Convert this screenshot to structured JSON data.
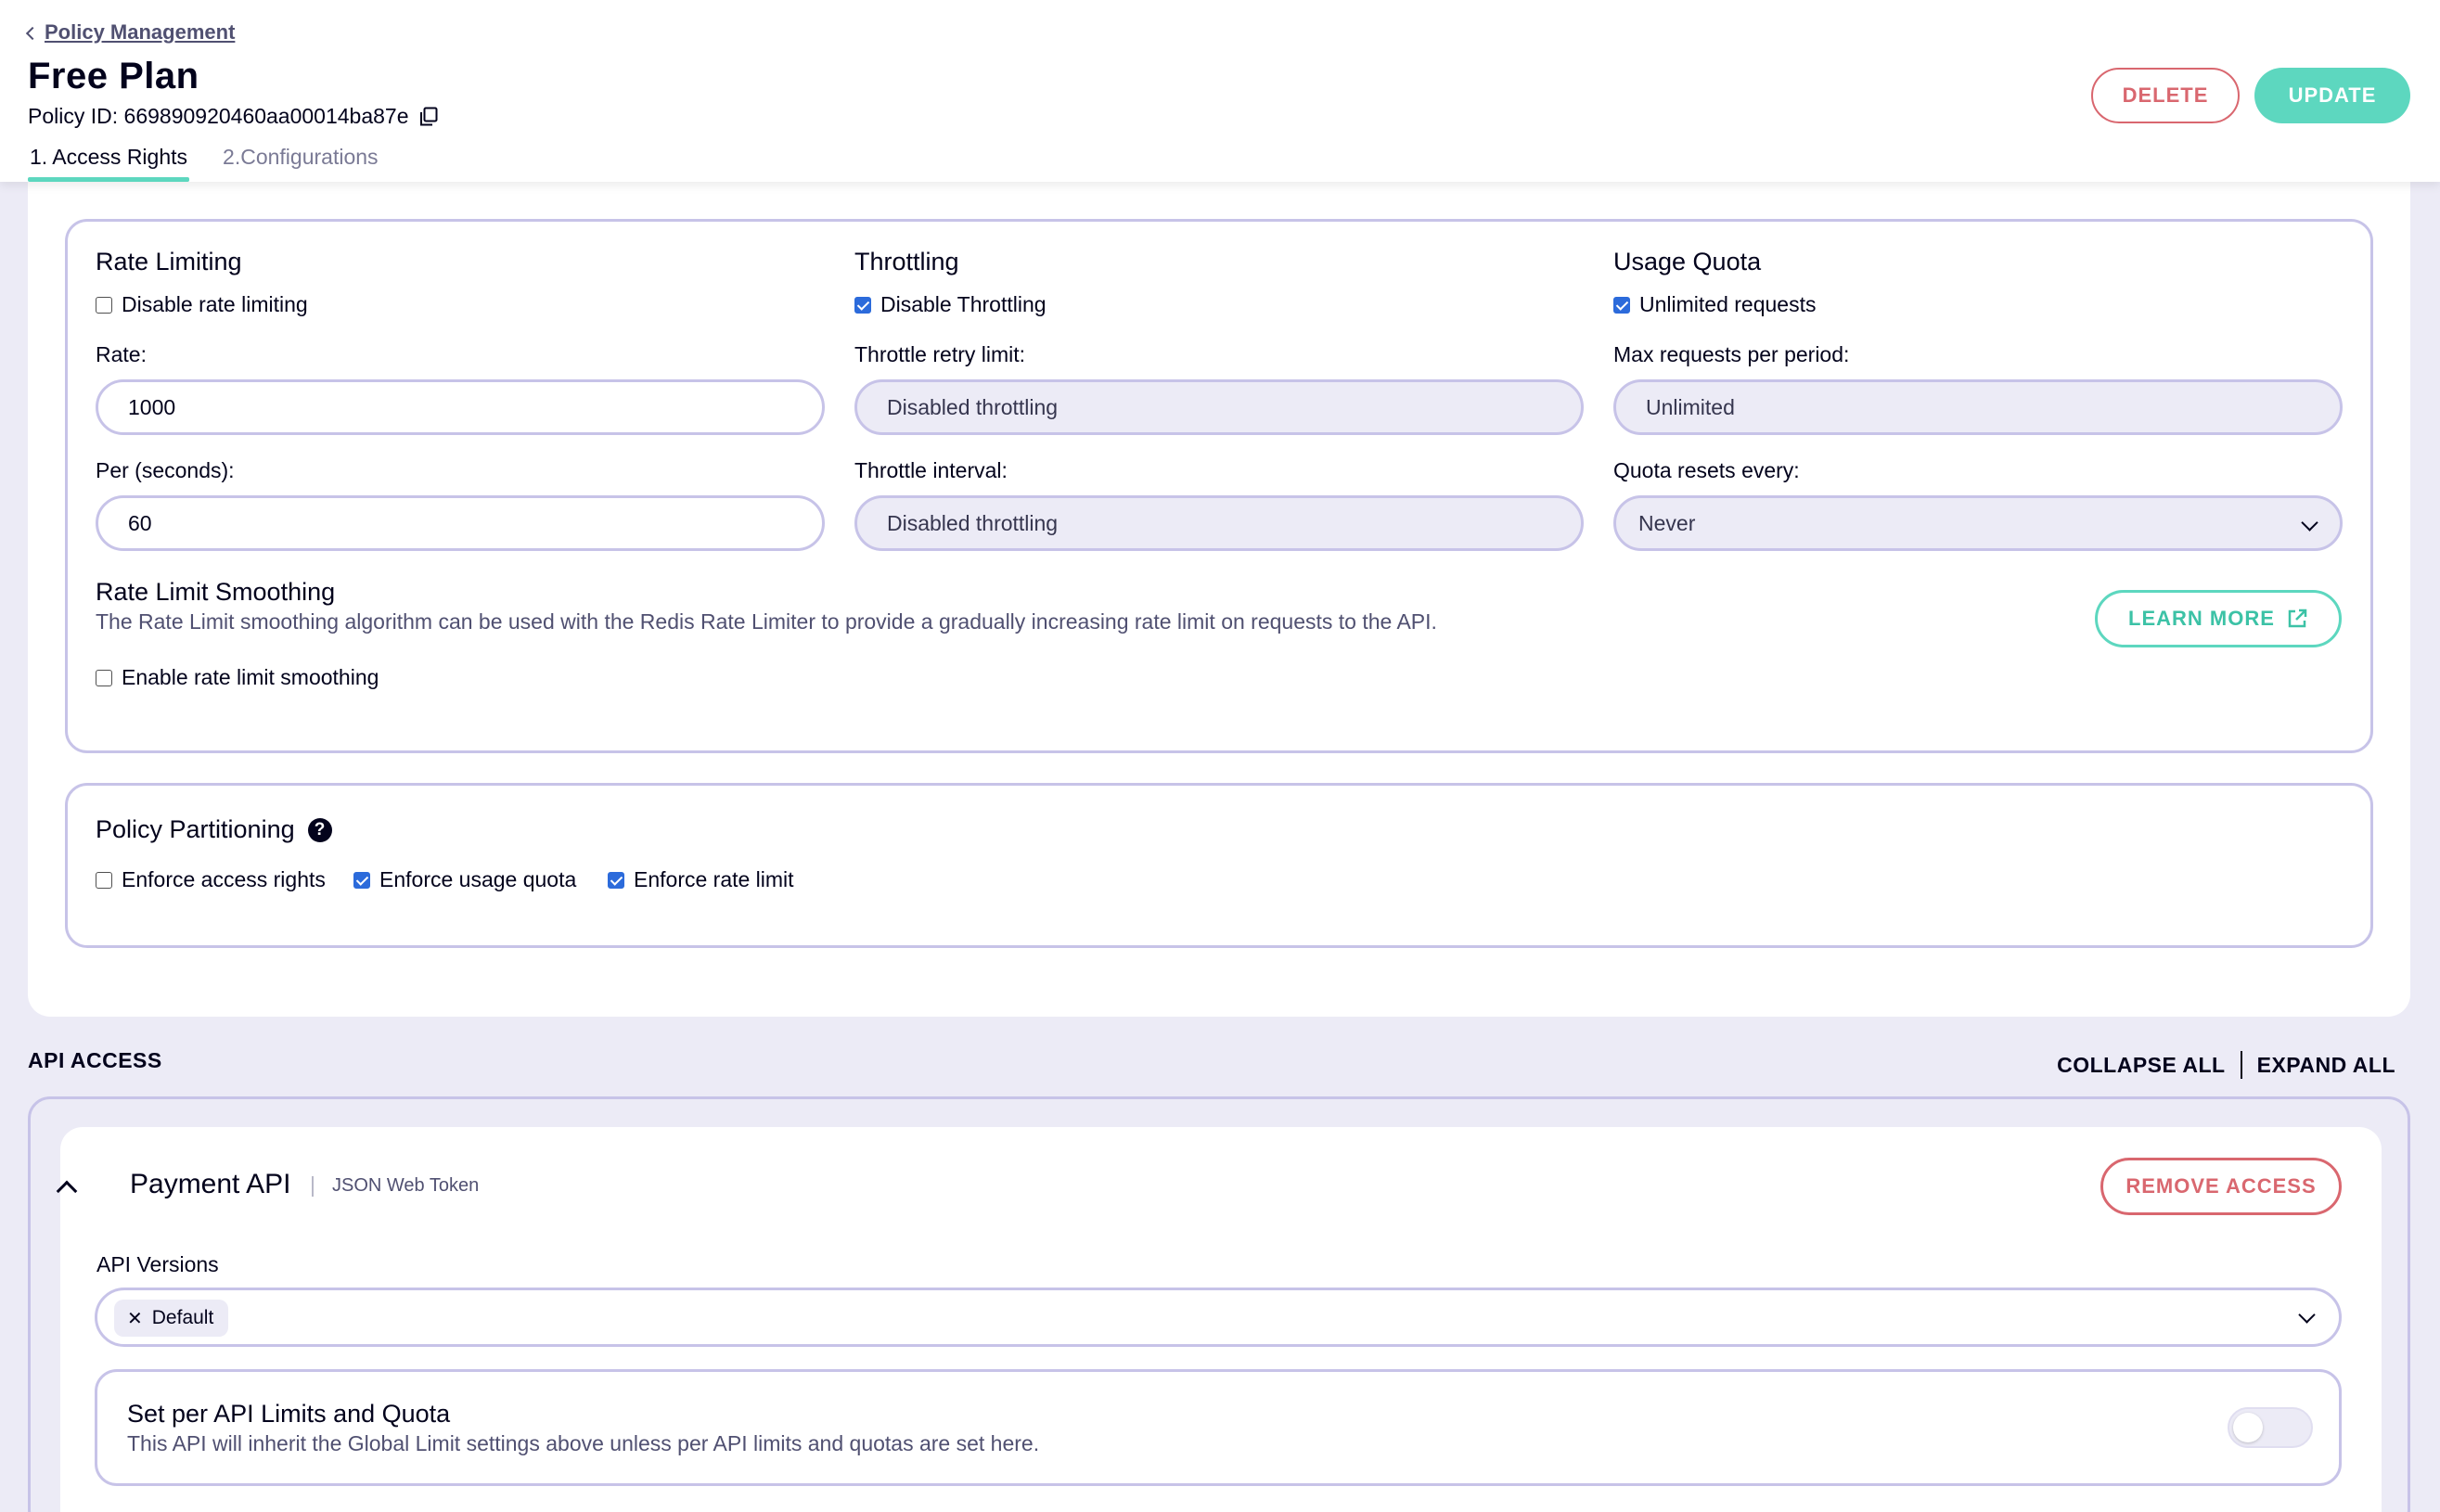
{
  "header": {
    "back_link": "Policy Management",
    "title": "Free Plan",
    "policy_id": "Policy ID: 669890920460aa00014ba87e",
    "delete_label": "DELETE",
    "update_label": "UPDATE",
    "tabs": [
      {
        "label": "1. Access Rights",
        "active": true
      },
      {
        "label": "2.Configurations",
        "active": false
      }
    ]
  },
  "rate_limiting": {
    "title": "Rate Limiting",
    "disable_label": "Disable rate limiting",
    "disable_checked": false,
    "rate_label": "Rate:",
    "rate_value": "1000",
    "per_label": "Per (seconds):",
    "per_value": "60"
  },
  "throttling": {
    "title": "Throttling",
    "disable_label": "Disable Throttling",
    "disable_checked": true,
    "retry_label": "Throttle retry limit:",
    "retry_value": "Disabled throttling",
    "interval_label": "Throttle interval:",
    "interval_value": "Disabled throttling"
  },
  "usage_quota": {
    "title": "Usage Quota",
    "unlimited_label": "Unlimited requests",
    "unlimited_checked": true,
    "max_label": "Max requests per period:",
    "max_value": "Unlimited",
    "resets_label": "Quota resets every:",
    "resets_value": "Never"
  },
  "smoothing": {
    "title": "Rate Limit Smoothing",
    "description": "The Rate Limit smoothing algorithm can be used with the Redis Rate Limiter to provide a gradually increasing rate limit on requests to the API.",
    "learn_more_label": "LEARN MORE",
    "enable_label": "Enable rate limit smoothing",
    "enable_checked": false
  },
  "partitioning": {
    "title": "Policy Partitioning",
    "options": [
      {
        "label": "Enforce access rights",
        "checked": false
      },
      {
        "label": "Enforce usage quota",
        "checked": true
      },
      {
        "label": "Enforce rate limit",
        "checked": true
      }
    ]
  },
  "api_access": {
    "label": "API ACCESS",
    "collapse_all": "COLLAPSE ALL",
    "expand_all": "EXPAND ALL",
    "api": {
      "name": "Payment API",
      "auth_type": "JSON Web Token",
      "remove_label": "REMOVE ACCESS",
      "versions_label": "API Versions",
      "versions": [
        "Default"
      ],
      "limits_title": "Set per API Limits and Quota",
      "limits_desc": "This API will inherit the Global Limit settings above unless per API limits and quotas are set here.",
      "limits_enabled": false
    }
  },
  "colors": {
    "accent": "#5dd7bf",
    "danger": "#d9676f",
    "border": "#c7c3e8",
    "background": "#ecebf6",
    "checkbox": "#2c6bdb"
  }
}
